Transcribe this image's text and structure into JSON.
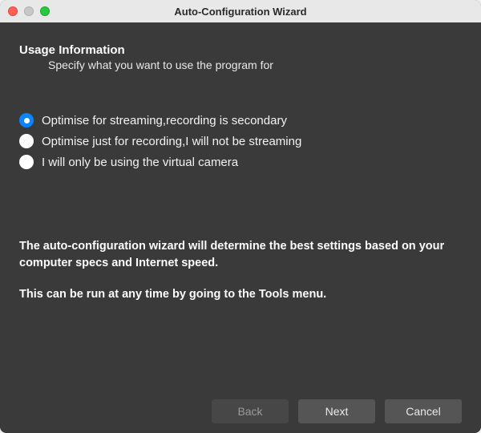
{
  "window": {
    "title": "Auto-Configuration Wizard"
  },
  "header": {
    "title": "Usage Information",
    "subtitle": "Specify what you want to use the program for"
  },
  "options": [
    {
      "label": "Optimise for streaming,recording is secondary",
      "selected": true
    },
    {
      "label": "Optimise just for recording,I will not be streaming",
      "selected": false
    },
    {
      "label": "I will only be using the virtual camera",
      "selected": false
    }
  ],
  "info": {
    "line1": "The auto-configuration wizard will determine the best settings based on your computer specs and Internet speed.",
    "line2": "This can be run at any time by going to the Tools menu."
  },
  "buttons": {
    "back": "Back",
    "next": "Next",
    "cancel": "Cancel"
  }
}
